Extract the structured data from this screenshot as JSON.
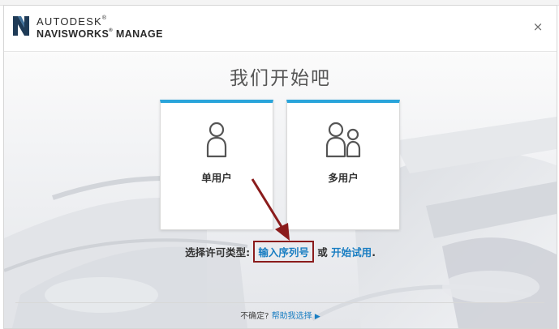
{
  "header": {
    "brand_top": "AUTODESK",
    "brand_bottom": "NAVISWORKS",
    "brand_product": "MANAGE",
    "trademark": "®",
    "close_glyph": "×"
  },
  "main": {
    "title": "我们开始吧",
    "cards": [
      {
        "label": "单用户",
        "icon": "single-user-icon"
      },
      {
        "label": "多用户",
        "icon": "multi-user-icon"
      }
    ],
    "license": {
      "prefix": "选择许可类型:",
      "serial_link": "输入序列号",
      "or": "或",
      "trial_link": "开始试用",
      "suffix": "."
    }
  },
  "footer": {
    "question": "不确定?",
    "help_link": "帮助我选择",
    "play_glyph": "▶"
  },
  "colors": {
    "accent": "#29a4da",
    "link": "#1a7ec2",
    "highlight_box": "#8b1c1c"
  }
}
